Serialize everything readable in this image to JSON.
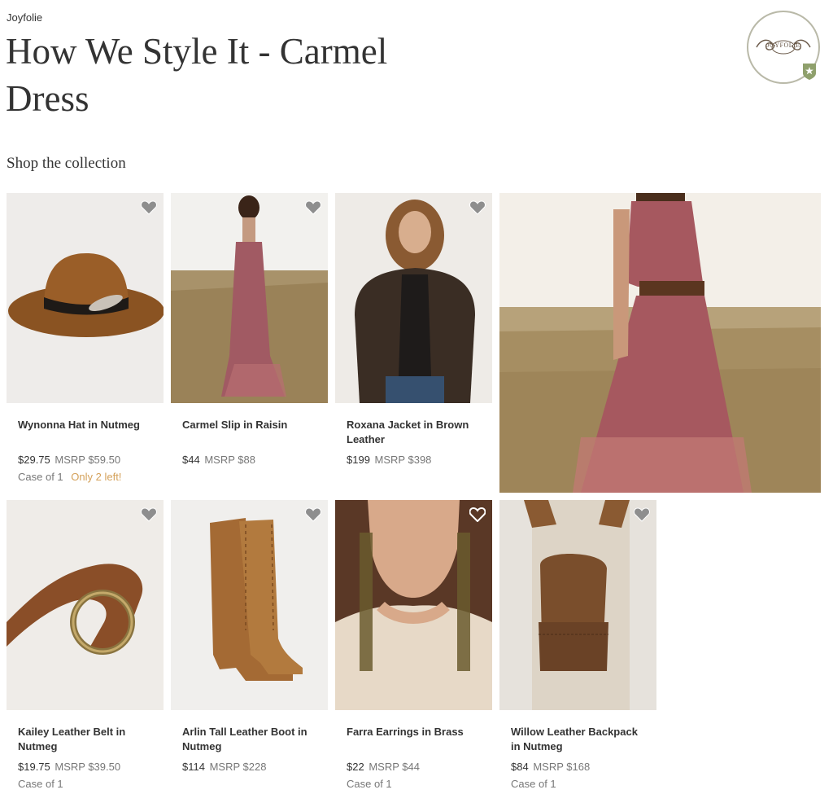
{
  "header": {
    "brand_link": "Joyfolie",
    "title": "How We Style It - Carmel Dress",
    "badge_text": "JOYFOLIE"
  },
  "collection": {
    "title": "Shop the collection",
    "products": [
      {
        "name": "Wynonna Hat in Nutmeg",
        "price": "$29.75",
        "msrp": "MSRP $59.50",
        "case": "Case of 1",
        "stock_note": "Only 2 left!"
      },
      {
        "name": "Carmel Slip in Raisin",
        "price": "$44",
        "msrp": "MSRP $88",
        "case": "",
        "stock_note": ""
      },
      {
        "name": "Roxana Jacket in Brown Leather",
        "price": "$199",
        "msrp": "MSRP $398",
        "case": "",
        "stock_note": ""
      },
      {
        "name": "Kailey Leather Belt in Nutmeg",
        "price": "$19.75",
        "msrp": "MSRP $39.50",
        "case": "Case of 1",
        "stock_note": ""
      },
      {
        "name": "Arlin Tall Leather Boot in Nutmeg",
        "price": "$114",
        "msrp": "MSRP $228",
        "case": "",
        "stock_note": ""
      },
      {
        "name": "Farra Earrings in Brass",
        "price": "$22",
        "msrp": "MSRP $44",
        "case": "Case of 1",
        "stock_note": ""
      },
      {
        "name": "Willow Leather Backpack in Nutmeg",
        "price": "$84",
        "msrp": "MSRP $168",
        "case": "Case of 1",
        "stock_note": ""
      }
    ]
  },
  "icons": {
    "favorite": "heart-icon",
    "brand": "joyfolie-badge",
    "shield": "shield-icon"
  },
  "colors": {
    "text": "#333333",
    "muted": "#777777",
    "stock_warning": "#d4a15a",
    "heart": "#8e8e8e"
  }
}
